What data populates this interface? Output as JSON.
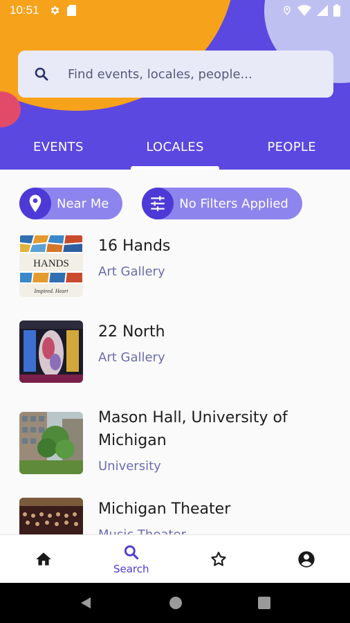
{
  "status_bar": {
    "time": "10:51"
  },
  "search": {
    "placeholder": "Find events, locales, people..."
  },
  "tabs": [
    {
      "label": "EVENTS",
      "active": false
    },
    {
      "label": "LOCALES",
      "active": true
    },
    {
      "label": "PEOPLE",
      "active": false
    }
  ],
  "filters": {
    "near_me_label": "Near Me",
    "filters_label": "No Filters Applied"
  },
  "locales": [
    {
      "name": "16 Hands",
      "category": "Art Gallery"
    },
    {
      "name": "22 North",
      "category": "Art Gallery"
    },
    {
      "name": "Mason Hall, University of Michigan",
      "category": "University"
    },
    {
      "name": "Michigan Theater",
      "category": "Music Theater"
    }
  ],
  "bottom_nav": [
    {
      "icon": "home-icon",
      "label": ""
    },
    {
      "icon": "search-icon",
      "label": "Search",
      "active": true
    },
    {
      "icon": "star-icon",
      "label": ""
    },
    {
      "icon": "account-icon",
      "label": ""
    }
  ],
  "colors": {
    "primary": "#5b48e0",
    "accent_orange": "#f7a21b",
    "chip": "#8e84ee",
    "category_text": "#6c6cb0"
  }
}
